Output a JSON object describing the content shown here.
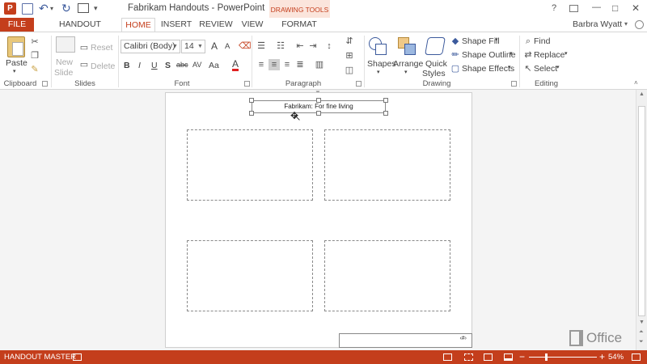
{
  "app": {
    "title": "Fabrikam Handouts - PowerPoint",
    "context_tab_group": "DRAWING TOOLS",
    "user": "Barbra Wyatt",
    "accent": "#c43e1c",
    "window_controls": {
      "help": "?",
      "minimize": "—",
      "restore": "□",
      "close": "✕"
    }
  },
  "qat": {
    "icons": [
      "powerpoint-logo-icon",
      "save-icon",
      "undo-icon",
      "redo-icon",
      "present-icon",
      "customize-icon"
    ],
    "undo_glyph": "↶",
    "dropdown_glyph": "▾",
    "redo_glyph": "↻",
    "save_glyph": "▣",
    "more_glyph": "▾"
  },
  "tabs": [
    {
      "label": "FILE"
    },
    {
      "label": "HANDOUT MASTER"
    },
    {
      "label": "HOME"
    },
    {
      "label": "INSERT"
    },
    {
      "label": "REVIEW"
    },
    {
      "label": "VIEW"
    },
    {
      "label": "FORMAT"
    }
  ],
  "ribbon": {
    "clipboard": {
      "label": "Clipboard",
      "paste": "Paste"
    },
    "slides": {
      "label": "Slides",
      "new_slide_line1": "New",
      "new_slide_line2": "Slide",
      "reset": "Reset",
      "delete": "Delete"
    },
    "font": {
      "label": "Font",
      "font_name": "Calibri (Body)",
      "font_size": "14",
      "bold": "B",
      "italic": "I",
      "underline": "U",
      "shadow": "S",
      "strike": "abc",
      "spacing": "AV",
      "case": "Aa",
      "color": "A",
      "grow": "A",
      "shrink": "A"
    },
    "paragraph": {
      "label": "Paragraph"
    },
    "drawing": {
      "label": "Drawing",
      "shapes": "Shapes",
      "arrange": "Arrange",
      "quick_styles_line1": "Quick",
      "quick_styles_line2": "Styles",
      "shape_fill": "Shape Fill",
      "shape_outline": "Shape Outline",
      "shape_effects": "Shape Effects"
    },
    "editing": {
      "label": "Editing",
      "find": "Find",
      "replace": "Replace",
      "select": "Select"
    }
  },
  "document": {
    "header_text": "Fabrikam: For fine living",
    "page_number_glyph": "‹#›"
  },
  "watermark": {
    "text": "Office"
  },
  "status": {
    "mode": "HANDOUT MASTER",
    "zoom": "54%",
    "zoom_level": 0.54
  }
}
